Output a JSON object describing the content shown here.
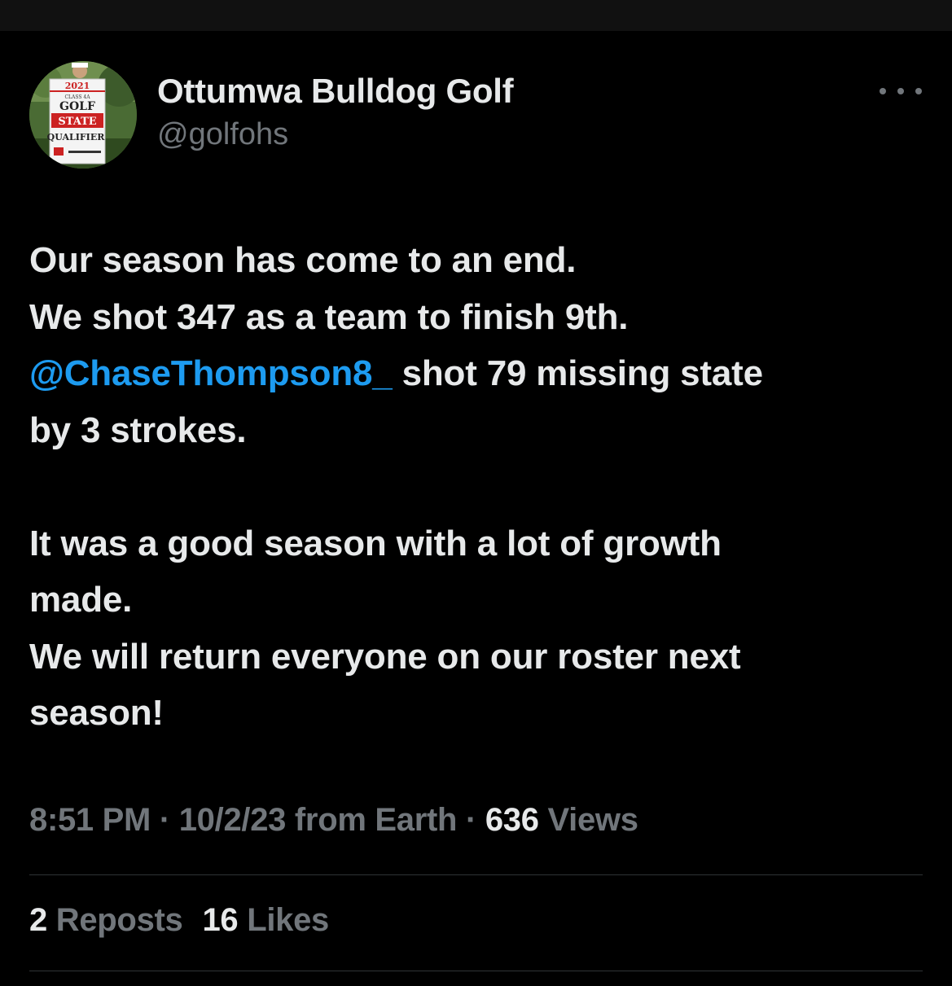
{
  "author": {
    "name": "Ottumwa Bulldog Golf",
    "handle": "@golfohs",
    "avatar": {
      "icon": "profile-photo-state-qualifier-banner",
      "banner_lines": [
        "2021",
        "CLASS 4A",
        "GOLF",
        "STATE",
        "QUALIFIER"
      ]
    }
  },
  "tweet": {
    "lines": [
      "Our season has come to an end.",
      "We shot 347 as a team to finish 9th."
    ],
    "mention": "@ChaseThompson8_",
    "mention_rest": " shot 79 missing state",
    "line4": "by 3 strokes.",
    "para2": [
      "It was a good season with a lot of growth",
      "made.",
      "We will return everyone on our roster next",
      "season!"
    ]
  },
  "meta": {
    "time": "8:51 PM",
    "separator": " · ",
    "date": "10/2/23",
    "source": " from Earth",
    "views_count": "636",
    "views_label": " Views"
  },
  "stats": {
    "reposts_count": "2",
    "reposts_label": " Reposts",
    "likes_count": "16",
    "likes_label": " Likes"
  },
  "colors": {
    "background": "#000000",
    "text": "#e7e9ea",
    "secondary": "#71767b",
    "link": "#1d9bf0",
    "divider": "#2f3336"
  }
}
